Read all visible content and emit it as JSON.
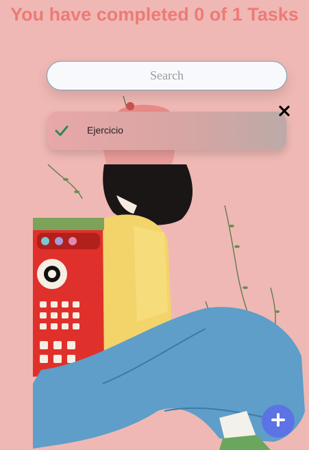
{
  "header": {
    "title": "You have completed 0 of 1 Tasks"
  },
  "search": {
    "placeholder": "Search",
    "value": ""
  },
  "tasks": [
    {
      "label": "Ejercicio",
      "completed": true
    }
  ],
  "icons": {
    "check": "check-icon",
    "delete": "close-icon",
    "add": "plus-icon"
  },
  "colors": {
    "background": "#efb8b4",
    "title": "#ee7a76",
    "check": "#2a8a5a",
    "fab": "#5b73e4"
  }
}
